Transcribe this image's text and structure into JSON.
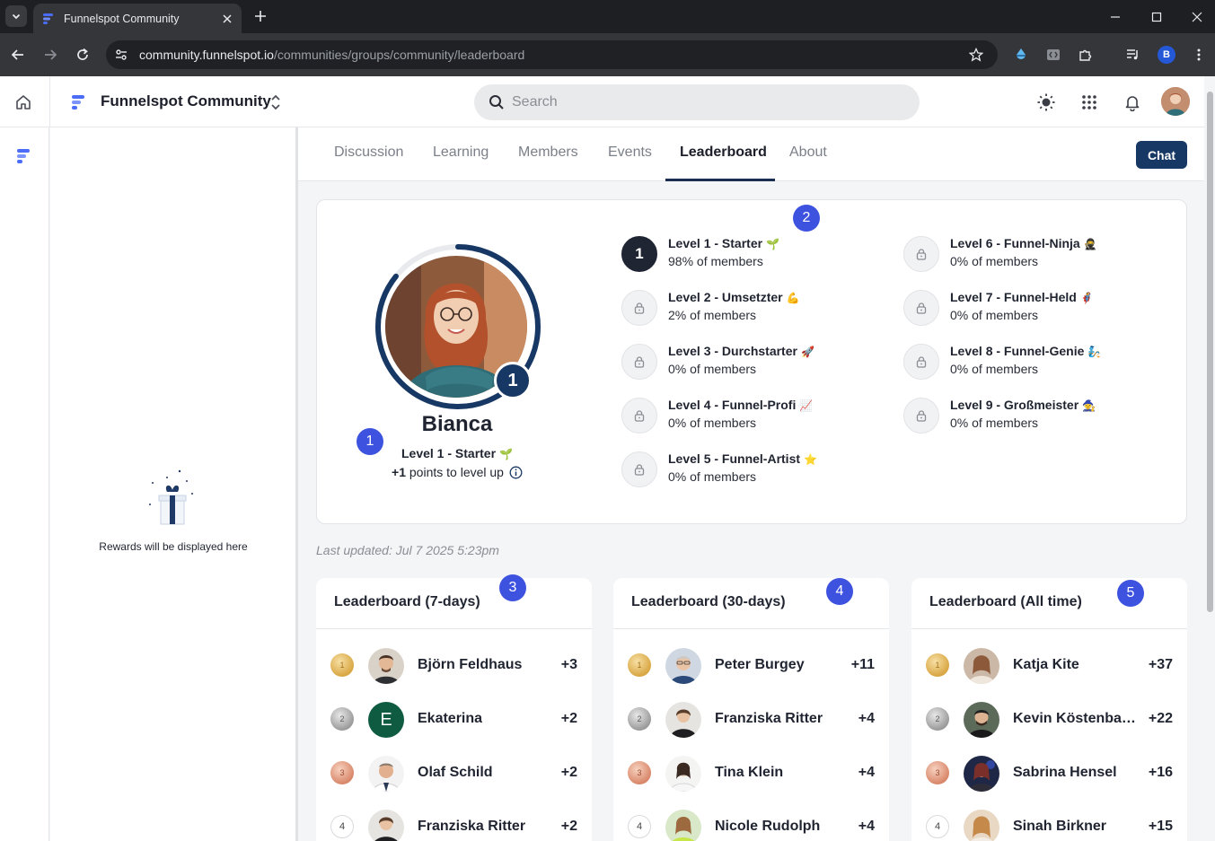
{
  "browser": {
    "tab_title": "Funnelspot Community",
    "url_host": "community.funnelspot.io",
    "url_path": "/communities/groups/community/leaderboard",
    "profile_initial": "B"
  },
  "header": {
    "brand_name": "Funnelspot Community",
    "search_placeholder": "Search"
  },
  "rewards": {
    "empty_text": "Rewards will be displayed here"
  },
  "nav": {
    "tabs": [
      {
        "label": "Discussion"
      },
      {
        "label": "Learning"
      },
      {
        "label": "Members"
      },
      {
        "label": "Events"
      },
      {
        "label": "Leaderboard"
      },
      {
        "label": "About"
      }
    ],
    "active_tab": "Leaderboard",
    "chat_label": "Chat"
  },
  "profile": {
    "name": "Bianca",
    "level_number": "1",
    "level_name": "Level 1 - Starter",
    "level_emoji": "🌱",
    "points_value": "+1",
    "points_suffix": " points to level up"
  },
  "levels": [
    {
      "name": "Level 1 - Starter",
      "emoji": "🌱",
      "pct": "98% of members",
      "current": "1"
    },
    {
      "name": "Level 2 - Umsetzter",
      "emoji": "💪",
      "pct": "2% of members"
    },
    {
      "name": "Level 3 - Durchstarter",
      "emoji": "🚀",
      "pct": "0% of members"
    },
    {
      "name": "Level 4 - Funnel-Profi",
      "emoji": "📈",
      "pct": "0% of members"
    },
    {
      "name": "Level 5 - Funnel-Artist",
      "emoji": "⭐",
      "pct": "0% of members"
    },
    {
      "name": "Level 6 - Funnel-Ninja",
      "emoji": "🥷",
      "pct": "0% of members"
    },
    {
      "name": "Level 7 - Funnel-Held",
      "emoji": "🦸",
      "pct": "0% of members"
    },
    {
      "name": "Level 8 - Funnel-Genie",
      "emoji": "🧞",
      "pct": "0% of members"
    },
    {
      "name": "Level 9 - Großmeister",
      "emoji": "🧙",
      "pct": "0% of members"
    }
  ],
  "last_updated": "Last updated: Jul 7 2025 5:23pm",
  "annotations": [
    "1",
    "2",
    "3",
    "4",
    "5"
  ],
  "leaderboards": [
    {
      "title": "Leaderboard (7-days)",
      "rows": [
        {
          "rank": "1",
          "name": "Björn Feldhaus",
          "points": "+3"
        },
        {
          "rank": "2",
          "name": "Ekaterina",
          "points": "+2",
          "initial": "E"
        },
        {
          "rank": "3",
          "name": "Olaf Schild",
          "points": "+2"
        },
        {
          "rank": "4",
          "name": "Franziska Ritter",
          "points": "+2"
        }
      ]
    },
    {
      "title": "Leaderboard (30-days)",
      "rows": [
        {
          "rank": "1",
          "name": "Peter Burgey",
          "points": "+11"
        },
        {
          "rank": "2",
          "name": "Franziska Ritter",
          "points": "+4"
        },
        {
          "rank": "3",
          "name": "Tina Klein",
          "points": "+4"
        },
        {
          "rank": "4",
          "name": "Nicole Rudolph",
          "points": "+4"
        }
      ]
    },
    {
      "title": "Leaderboard (All time)",
      "rows": [
        {
          "rank": "1",
          "name": "Katja Kite",
          "points": "+37"
        },
        {
          "rank": "2",
          "name": "Kevin Köstenbau...",
          "points": "+22"
        },
        {
          "rank": "3",
          "name": "Sabrina Hensel",
          "points": "+16"
        },
        {
          "rank": "4",
          "name": "Sinah Birkner",
          "points": "+15"
        }
      ]
    }
  ],
  "colors": {
    "accent_navy": "#173864",
    "annotation_blue": "#3e52e0",
    "brand_blue": "#4a6cf7"
  }
}
